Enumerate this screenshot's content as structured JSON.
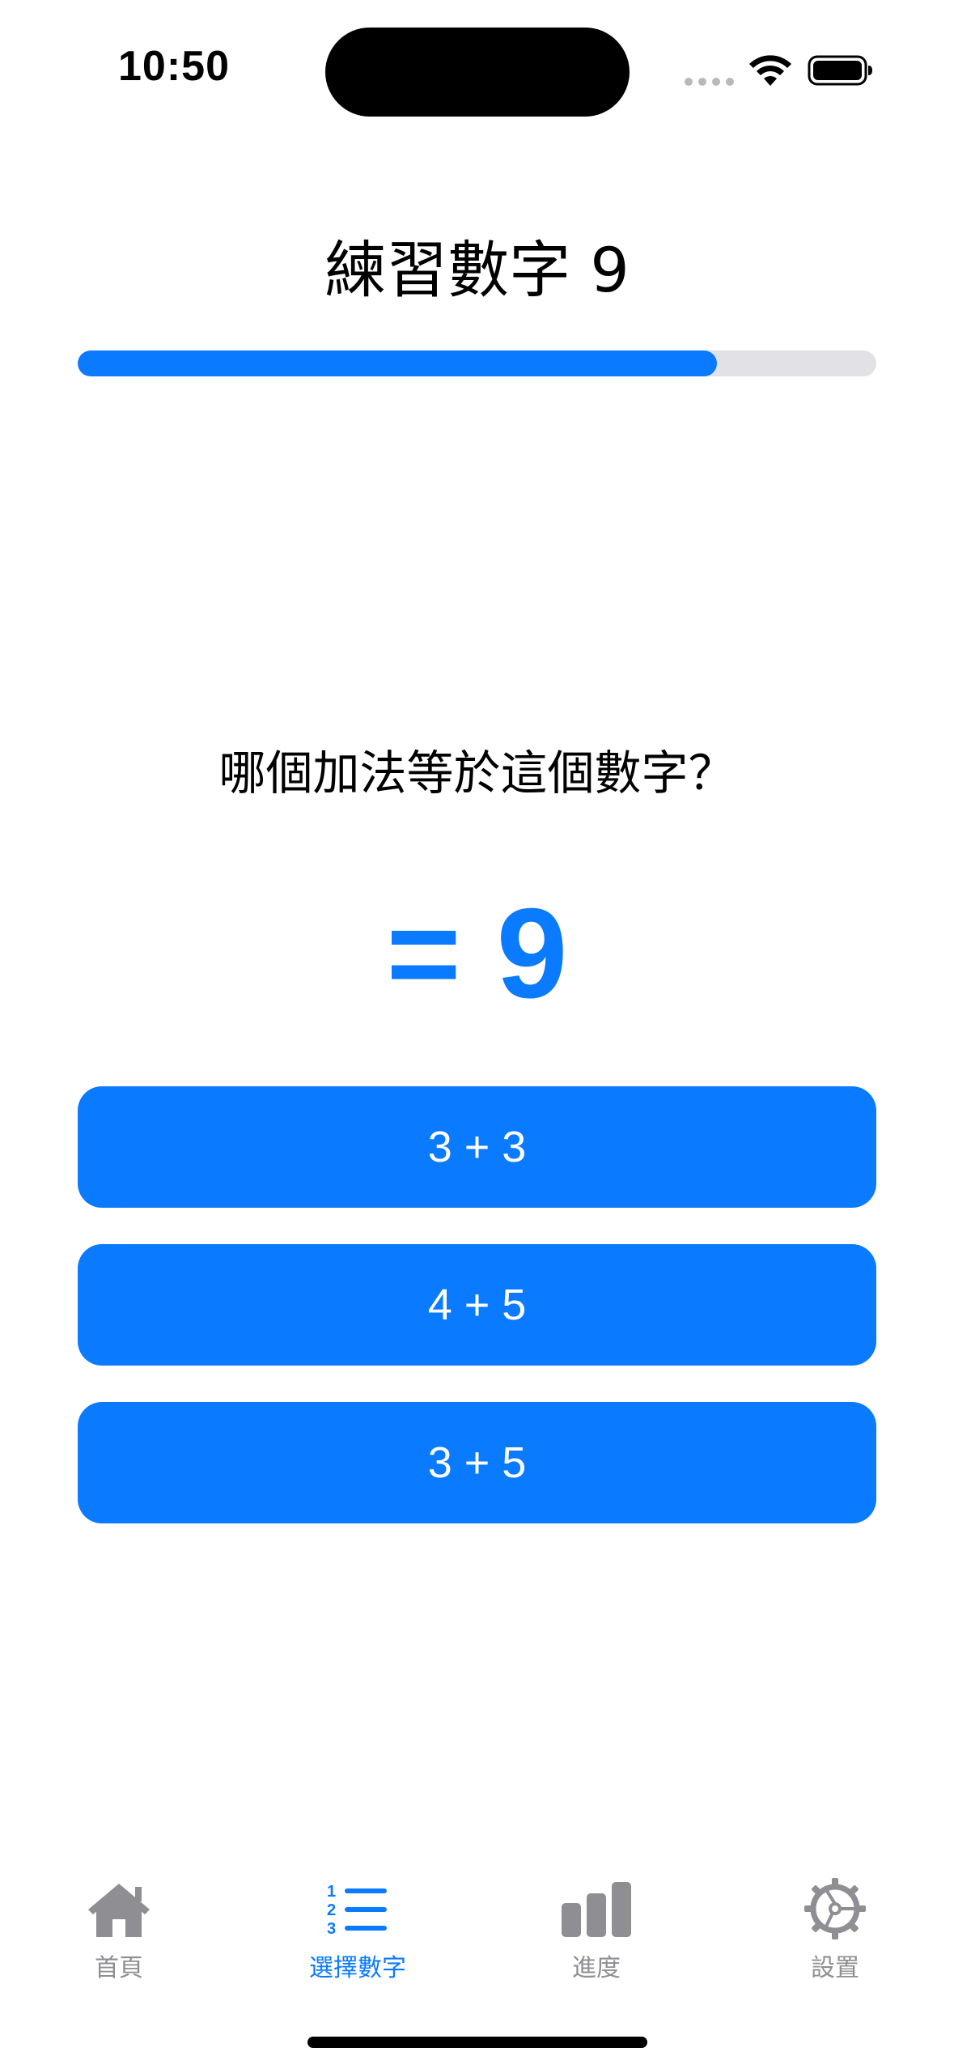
{
  "status_bar": {
    "time": "10:50"
  },
  "header": {
    "title": "練習數字 9"
  },
  "progress": {
    "fraction": 0.8
  },
  "question": {
    "prompt": "哪個加法等於這個數字？",
    "target": "= 9"
  },
  "answers": [
    {
      "label": "3 + 3"
    },
    {
      "label": "4 + 5"
    },
    {
      "label": "3 + 5"
    }
  ],
  "tab_bar": {
    "items": [
      {
        "label": "首頁",
        "icon": "house-icon",
        "active": false
      },
      {
        "label": "選擇數字",
        "icon": "numbered-list-icon",
        "active": true
      },
      {
        "label": "進度",
        "icon": "bar-chart-icon",
        "active": false
      },
      {
        "label": "設置",
        "icon": "gear-icon",
        "active": false
      }
    ]
  },
  "colors": {
    "accent": "#0A7AFF",
    "inactive": "#8E8E93",
    "progress_track": "#E2E2E6"
  }
}
